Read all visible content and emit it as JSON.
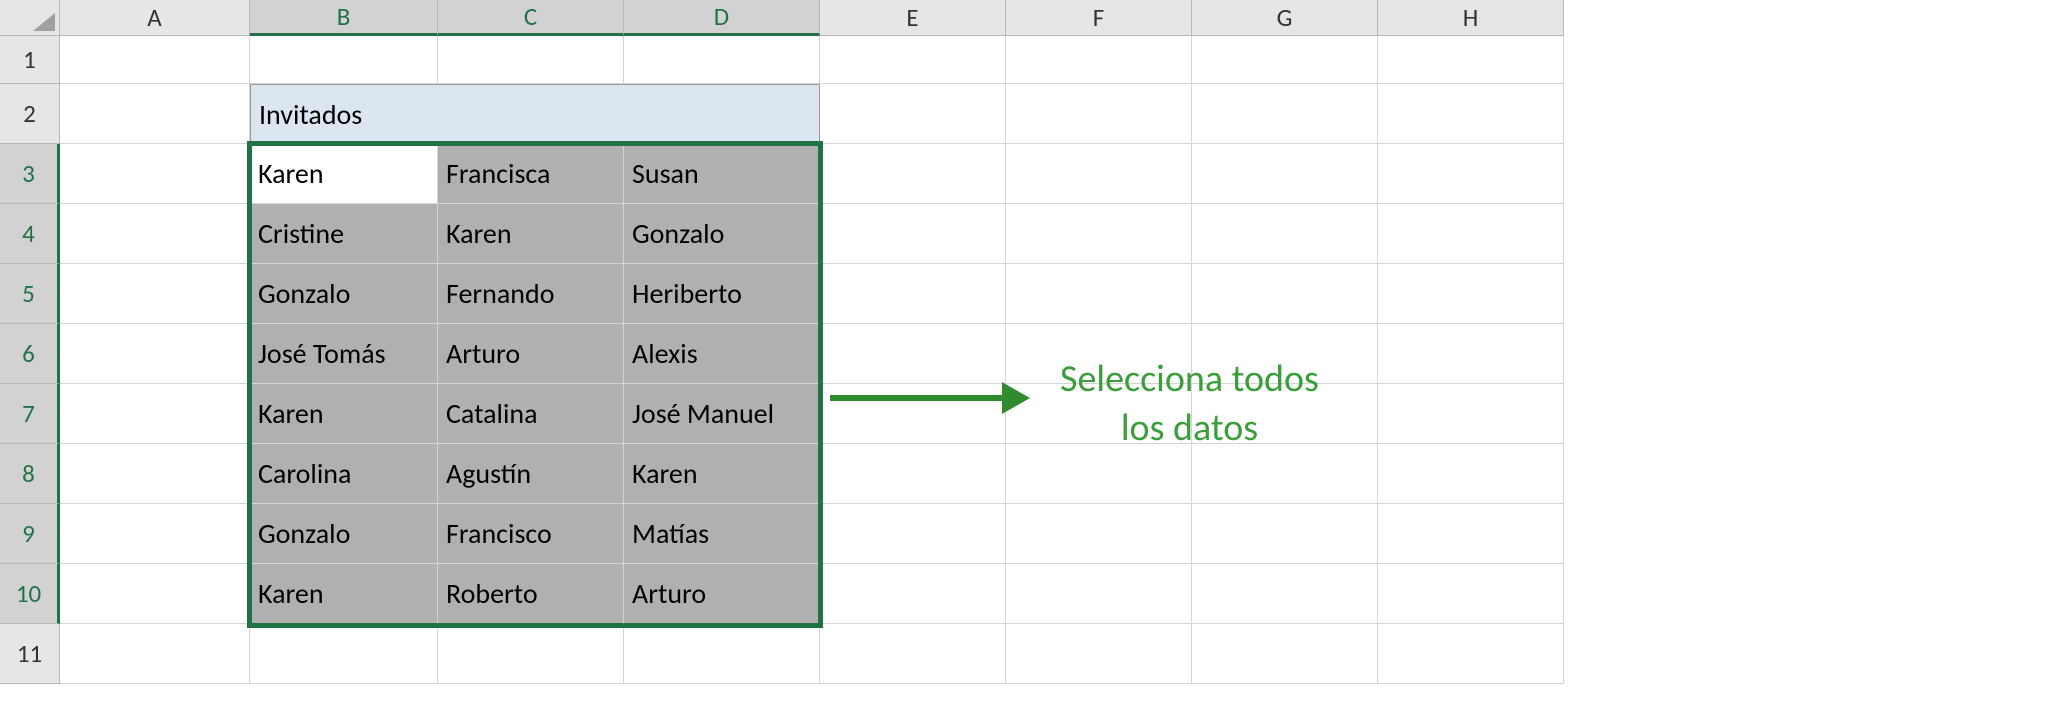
{
  "columns": [
    "A",
    "B",
    "C",
    "D",
    "E",
    "F",
    "G",
    "H"
  ],
  "rows_labels": [
    "1",
    "2",
    "3",
    "4",
    "5",
    "6",
    "7",
    "8",
    "9",
    "10",
    "11"
  ],
  "header_label": "Invitados",
  "table": [
    [
      "Karen",
      "Francisca",
      "Susan"
    ],
    [
      "Cristine",
      "Karen",
      "Gonzalo"
    ],
    [
      "Gonzalo",
      "Fernando",
      "Heriberto"
    ],
    [
      "José Tomás",
      "Arturo",
      "Alexis"
    ],
    [
      "Karen",
      "Catalina",
      "José Manuel"
    ],
    [
      "Carolina",
      "Agustín",
      "Karen"
    ],
    [
      "Gonzalo",
      "Francisco",
      "Matías"
    ],
    [
      "Karen",
      "Roberto",
      "Arturo"
    ]
  ],
  "annotation": {
    "line1": "Selecciona todos",
    "line2": "los datos"
  },
  "selection": {
    "active_cell": "B3",
    "range": "B3:D10",
    "selected_cols": [
      "B",
      "C",
      "D"
    ],
    "selected_rows": [
      "3",
      "4",
      "5",
      "6",
      "7",
      "8",
      "9",
      "10"
    ]
  },
  "colors": {
    "brand_green": "#217346",
    "selection_fill": "#b0b0b0",
    "header_fill": "#dce6f1",
    "annotation_green": "#3a9e3a"
  }
}
